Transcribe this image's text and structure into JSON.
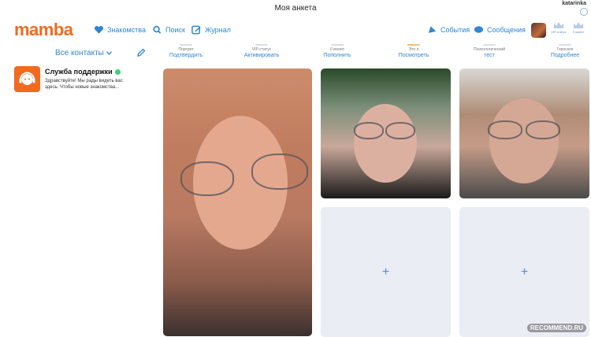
{
  "window": {
    "title": "Моя анкета",
    "username": "katarinka"
  },
  "header": {
    "logo": "mamba",
    "nav": [
      {
        "label": "Знакомства",
        "icon": "heart-icon"
      },
      {
        "label": "Поиск",
        "icon": "search-icon"
      },
      {
        "label": "Журнал",
        "icon": "journal-icon"
      },
      {
        "label": "События",
        "icon": "events-icon"
      },
      {
        "label": "Сообщения",
        "icon": "messages-icon"
      }
    ],
    "crowns": [
      {
        "label": "VIP-статус"
      },
      {
        "label": "0 монет"
      }
    ]
  },
  "sidebar": {
    "contacts_filter": "Все контакты",
    "chats": [
      {
        "name": "Служба поддержки",
        "message": "Здравствуйте! Мы рады видеть вас здесь. Чтобы новые знакомства..."
      }
    ]
  },
  "stats": [
    {
      "label": "Портрет",
      "action": "Подтвердить",
      "color": "#d9dde6"
    },
    {
      "label": "VIP-статус",
      "action": "Активировать",
      "color": "#d9dde6"
    },
    {
      "label": "0 монет",
      "action": "Пополнить",
      "color": "#d9dde6"
    },
    {
      "label": "Это я",
      "action": "Посмотреть",
      "color": "#f0c078"
    },
    {
      "label": "Психологический",
      "action": "тест",
      "color": "#d9dde6"
    },
    {
      "label": "Гороскоп",
      "action": "Подробнее",
      "color": "#d9dde6"
    }
  ],
  "photos": {
    "add_label": "+"
  },
  "watermark": "RECOMMEND.RU",
  "colors": {
    "accent": "#2d86d6",
    "brand": "#f06a1f",
    "online": "#3fcf7a"
  }
}
